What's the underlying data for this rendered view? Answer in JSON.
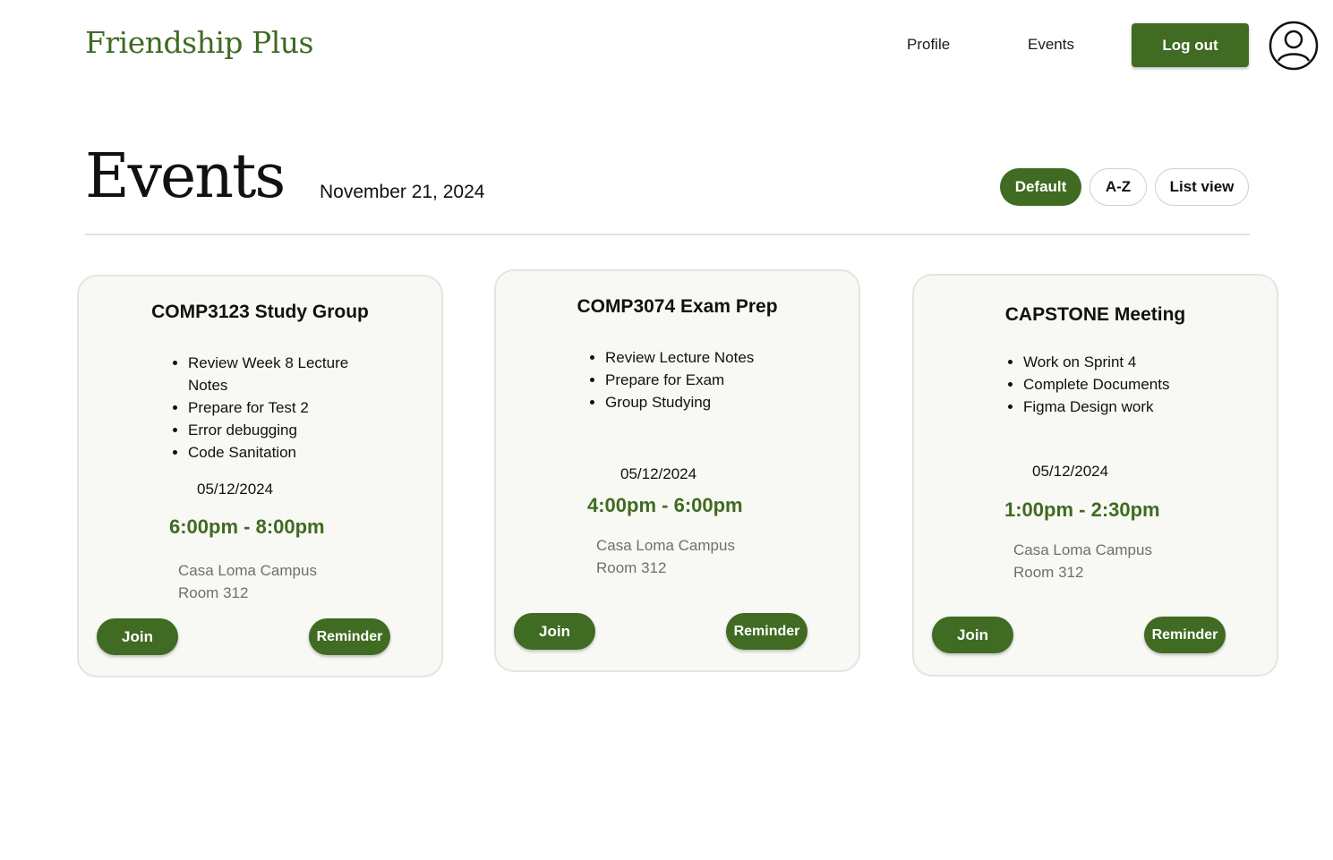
{
  "header": {
    "brand": "Friendship Plus",
    "nav": {
      "profile": "Profile",
      "events": "Events"
    },
    "logout_label": "Log out"
  },
  "page": {
    "title": "Events",
    "date": "November 21, 2024",
    "sort_options": [
      "Default",
      "A-Z",
      "List view"
    ],
    "active_sort": "Default"
  },
  "events": [
    {
      "title": "COMP3123 Study Group",
      "tasks": [
        "Review Week 8 Lecture Notes",
        "Prepare for Test 2",
        "Error debugging",
        "Code Sanitation"
      ],
      "date": "05/12/2024",
      "time": "6:00pm - 8:00pm",
      "location": "Casa Loma Campus",
      "room": "Room 312",
      "join_label": "Join",
      "reminder_label": "Reminder"
    },
    {
      "title": "COMP3074 Exam Prep",
      "tasks": [
        "Review Lecture Notes",
        "Prepare for Exam",
        "Group Studying"
      ],
      "date": "05/12/2024",
      "time": "4:00pm - 6:00pm",
      "location": "Casa Loma Campus",
      "room": "Room 312",
      "join_label": "Join",
      "reminder_label": "Reminder"
    },
    {
      "title": "CAPSTONE Meeting",
      "tasks": [
        "Work on Sprint 4",
        "Complete Documents",
        "Figma Design work"
      ],
      "date": "05/12/2024",
      "time": "1:00pm - 2:30pm",
      "location": "Casa Loma Campus",
      "room": "Room 312",
      "join_label": "Join",
      "reminder_label": "Reminder"
    }
  ],
  "colors": {
    "accent": "#3f6b22",
    "card_bg": "#f8f8f4",
    "muted_text": "#6f6f6f"
  },
  "icons": {
    "avatar": "user-circle-icon"
  }
}
